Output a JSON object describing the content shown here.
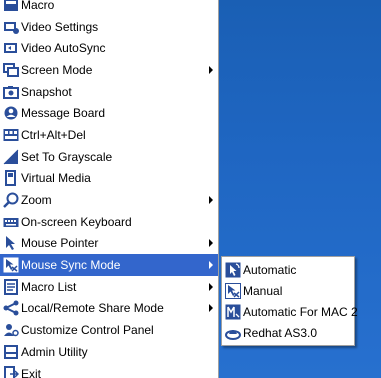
{
  "menu": {
    "items": [
      {
        "label": "Macro",
        "icon": "macro-icon",
        "submenu": false
      },
      {
        "label": "Video Settings",
        "icon": "video-settings-icon",
        "submenu": false
      },
      {
        "label": "Video AutoSync",
        "icon": "video-autosync-icon",
        "submenu": false
      },
      {
        "label": "Screen Mode",
        "icon": "screen-mode-icon",
        "submenu": true
      },
      {
        "label": "Snapshot",
        "icon": "snapshot-icon",
        "submenu": false
      },
      {
        "label": "Message Board",
        "icon": "message-board-icon",
        "submenu": false
      },
      {
        "label": "Ctrl+Alt+Del",
        "icon": "ctrl-alt-del-icon",
        "submenu": false
      },
      {
        "label": "Set To Grayscale",
        "icon": "grayscale-icon",
        "submenu": false
      },
      {
        "label": "Virtual Media",
        "icon": "virtual-media-icon",
        "submenu": false
      },
      {
        "label": "Zoom",
        "icon": "zoom-icon",
        "submenu": true
      },
      {
        "label": "On-screen Keyboard",
        "icon": "keyboard-icon",
        "submenu": false
      },
      {
        "label": "Mouse Pointer",
        "icon": "mouse-pointer-icon",
        "submenu": true
      },
      {
        "label": "Mouse Sync Mode",
        "icon": "mouse-sync-icon",
        "submenu": true
      },
      {
        "label": "Macro List",
        "icon": "macro-list-icon",
        "submenu": true
      },
      {
        "label": "Local/Remote Share Mode",
        "icon": "share-mode-icon",
        "submenu": true
      },
      {
        "label": "Customize Control Panel",
        "icon": "customize-icon",
        "submenu": false
      },
      {
        "label": "Admin Utility",
        "icon": "admin-utility-icon",
        "submenu": false
      },
      {
        "label": "Exit",
        "icon": "exit-icon",
        "submenu": false
      }
    ],
    "highlighted": "Mouse Sync Mode"
  },
  "submenu": {
    "items": [
      {
        "label": "Automatic",
        "icon": "automatic-icon"
      },
      {
        "label": "Manual",
        "icon": "manual-icon"
      },
      {
        "label": "Automatic For MAC 2",
        "icon": "automatic-mac-icon"
      },
      {
        "label": "Redhat AS3.0",
        "icon": "redhat-icon"
      }
    ]
  },
  "colors": {
    "highlight": "#3366cc",
    "desktop": "#1f66c2"
  }
}
